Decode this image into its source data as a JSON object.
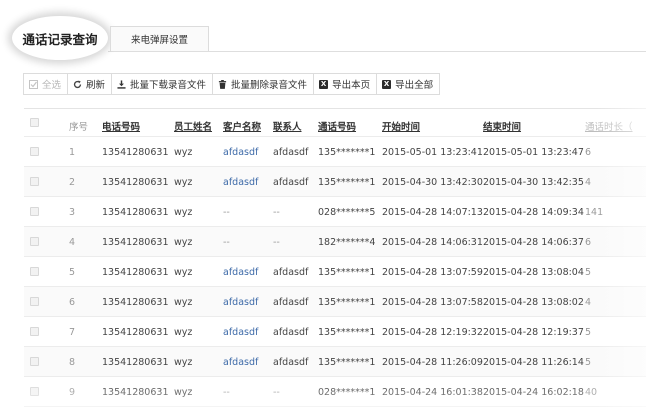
{
  "tabs": [
    {
      "label": "通话记录查询",
      "active": true
    },
    {
      "label": "来电弹屏设置",
      "active": false
    }
  ],
  "toolbar": {
    "select_all": "全选",
    "refresh": "刷新",
    "batch_download": "批量下载录音文件",
    "batch_delete": "批量删除录音文件",
    "export_page": "导出本页",
    "export_all": "导出全部",
    "excel_glyph": "X"
  },
  "table": {
    "headers": {
      "seq": "序号",
      "phone": "电话号码",
      "staff": "员工姓名",
      "customer": "客户名称",
      "contact": "联系人",
      "call_number": "通话号码",
      "start_time": "开始时间",
      "end_time": "结束时间",
      "duration": "通话时长（"
    },
    "rows": [
      {
        "seq": "1",
        "phone": "13541280631",
        "staff": "wyz",
        "customer": "afdasdf",
        "contact": "afdasdf",
        "call_number": "135*******1",
        "start": "2015-05-01 13:23:41",
        "end": "2015-05-01 13:23:47",
        "duration": "6"
      },
      {
        "seq": "2",
        "phone": "13541280631",
        "staff": "wyz",
        "customer": "afdasdf",
        "contact": "afdasdf",
        "call_number": "135*******1",
        "start": "2015-04-30 13:42:30",
        "end": "2015-04-30 13:42:35",
        "duration": "4"
      },
      {
        "seq": "3",
        "phone": "13541280631",
        "staff": "wyz",
        "customer": "--",
        "contact": "--",
        "call_number": "028*******5",
        "start": "2015-04-28 14:07:13",
        "end": "2015-04-28 14:09:34",
        "duration": "141"
      },
      {
        "seq": "4",
        "phone": "13541280631",
        "staff": "wyz",
        "customer": "--",
        "contact": "--",
        "call_number": "182*******4",
        "start": "2015-04-28 14:06:31",
        "end": "2015-04-28 14:06:37",
        "duration": "6"
      },
      {
        "seq": "5",
        "phone": "13541280631",
        "staff": "wyz",
        "customer": "afdasdf",
        "contact": "afdasdf",
        "call_number": "135*******1",
        "start": "2015-04-28 13:07:59",
        "end": "2015-04-28 13:08:04",
        "duration": "5"
      },
      {
        "seq": "6",
        "phone": "13541280631",
        "staff": "wyz",
        "customer": "afdasdf",
        "contact": "afdasdf",
        "call_number": "135*******1",
        "start": "2015-04-28 13:07:58",
        "end": "2015-04-28 13:08:02",
        "duration": "4"
      },
      {
        "seq": "7",
        "phone": "13541280631",
        "staff": "wyz",
        "customer": "afdasdf",
        "contact": "afdasdf",
        "call_number": "135*******1",
        "start": "2015-04-28 12:19:32",
        "end": "2015-04-28 12:19:37",
        "duration": "5"
      },
      {
        "seq": "8",
        "phone": "13541280631",
        "staff": "wyz",
        "customer": "afdasdf",
        "contact": "afdasdf",
        "call_number": "135*******1",
        "start": "2015-04-28 11:26:09",
        "end": "2015-04-28 11:26:14",
        "duration": "5"
      },
      {
        "seq": "9",
        "phone": "13541280631",
        "staff": "wyz",
        "customer": "--",
        "contact": "--",
        "call_number": "028*******1",
        "start": "2015-04-24 16:01:38",
        "end": "2015-04-24 16:02:18",
        "duration": "40"
      }
    ]
  },
  "colors": {
    "link": "#3d6aa8",
    "muted": "#999999",
    "border": "#dcdcdc"
  }
}
